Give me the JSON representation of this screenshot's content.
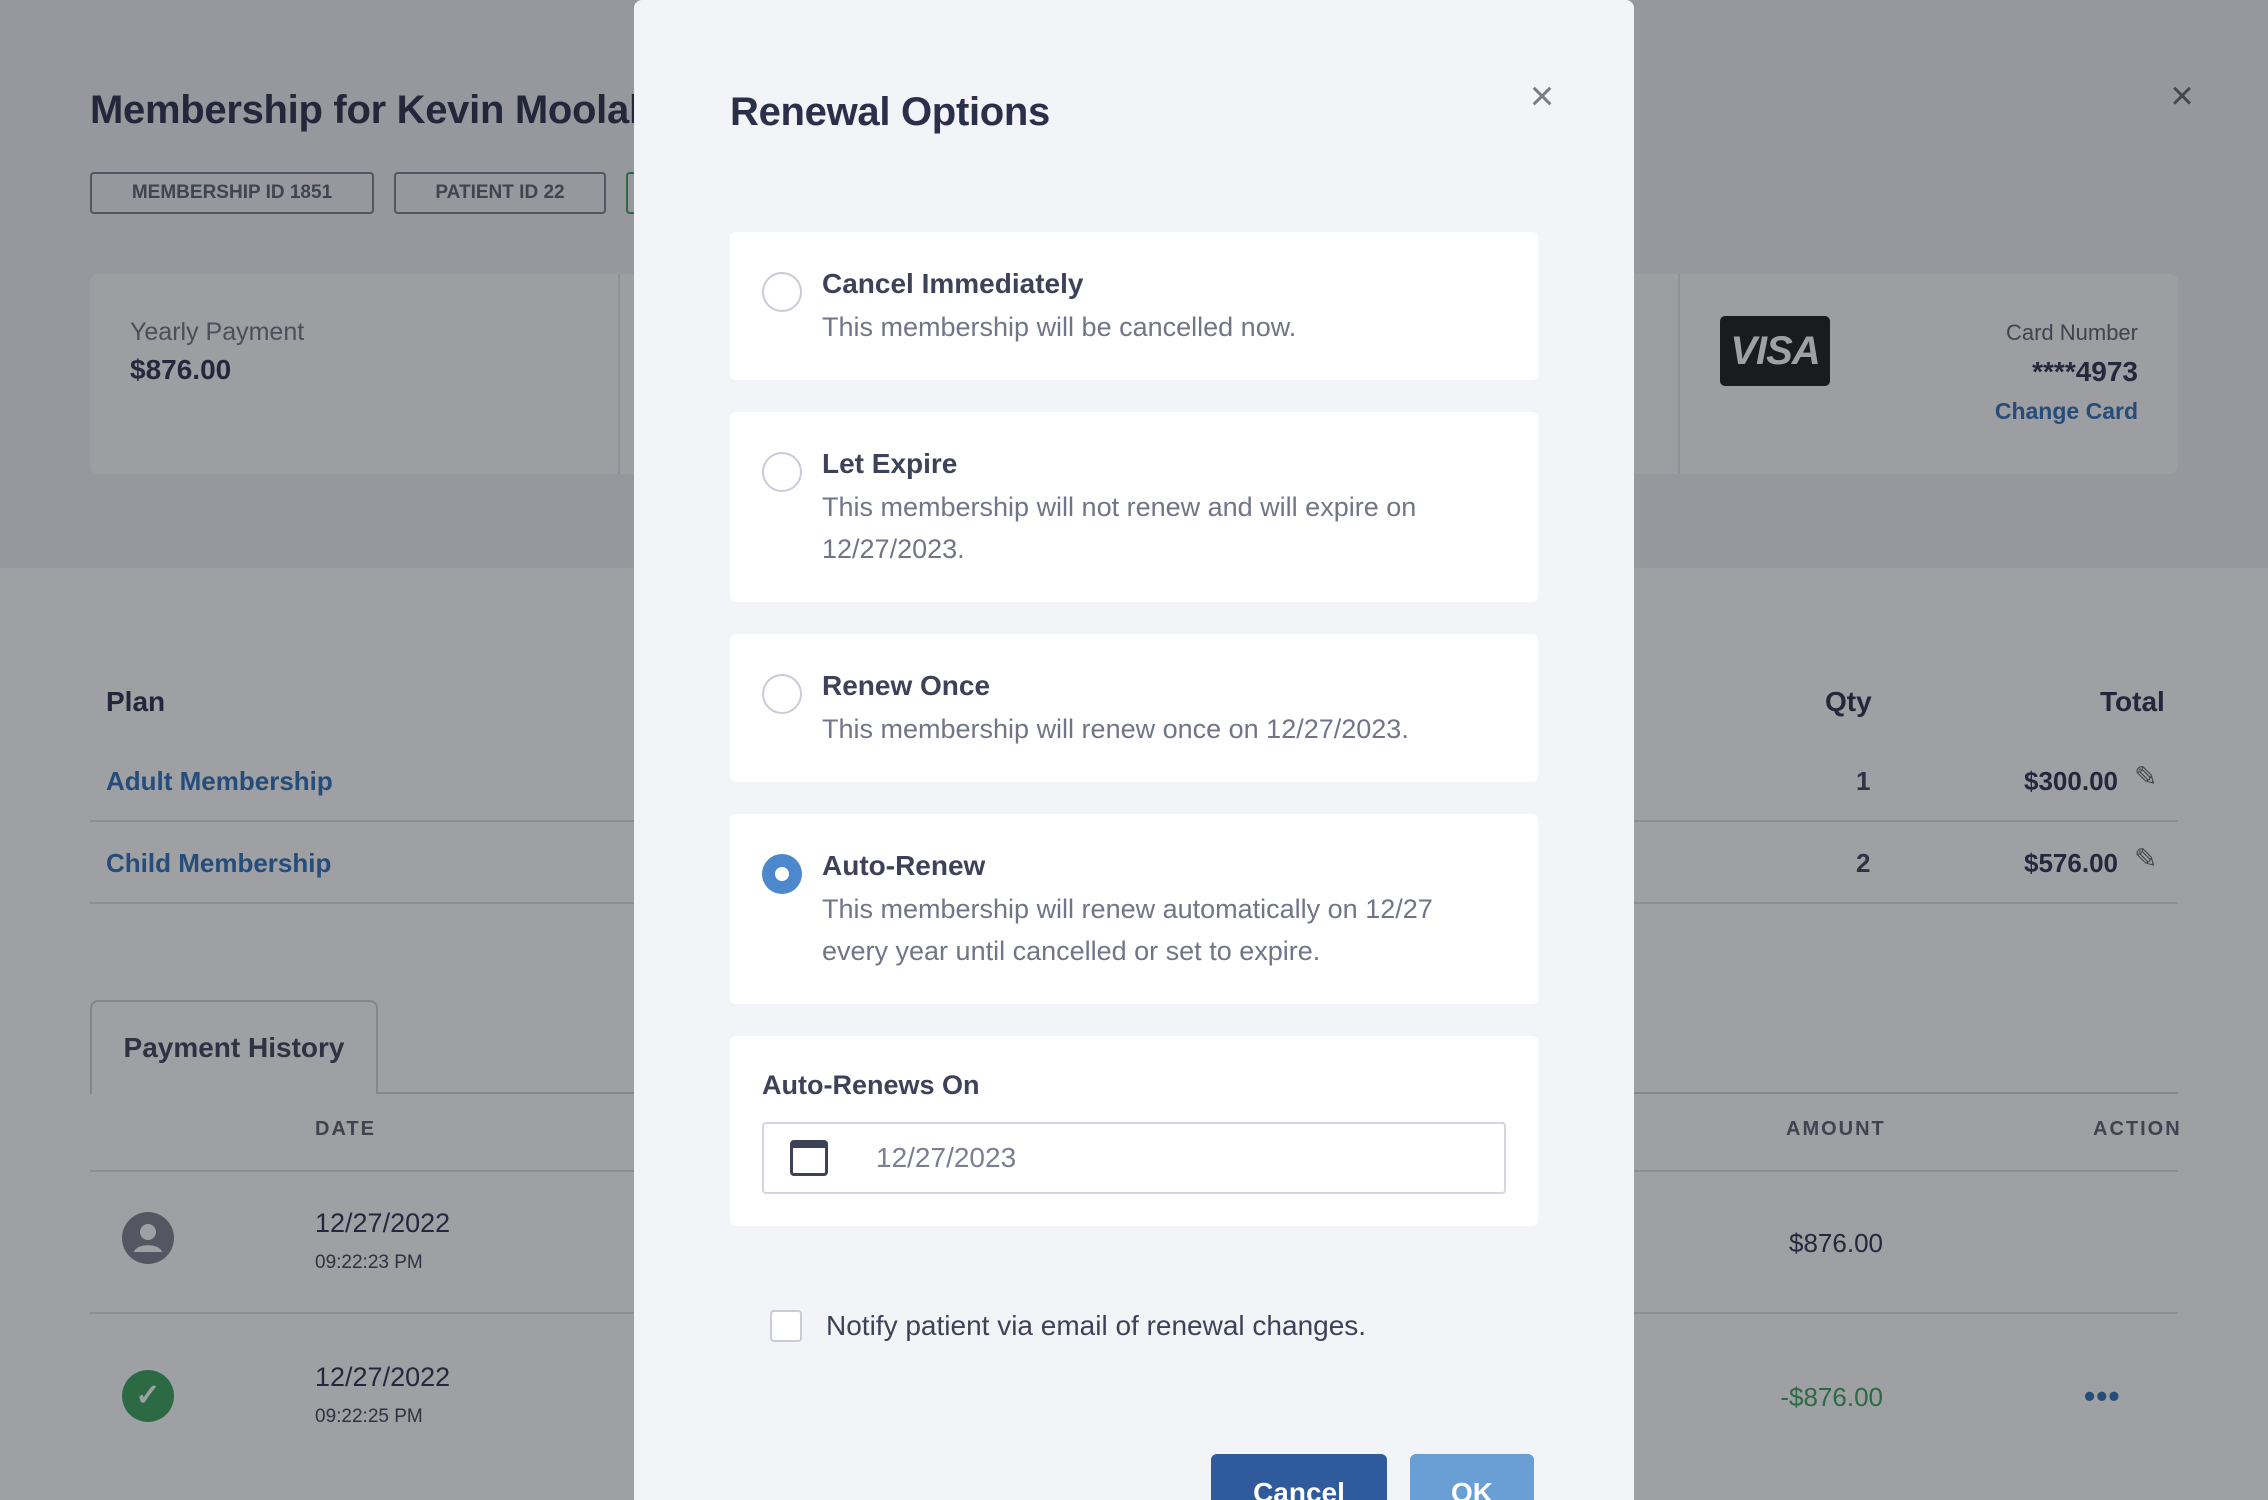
{
  "page": {
    "title": "Membership for Kevin Moolah",
    "close_icon": "×",
    "chips": [
      "MEMBERSHIP ID 1851",
      "PATIENT ID 22"
    ],
    "summary": {
      "payment_label": "Yearly Payment",
      "payment_value": "$876.00",
      "card_brand": "VISA",
      "card_number_label": "Card Number",
      "card_number": "****4973",
      "change_card": "Change Card"
    },
    "plans": {
      "headers": {
        "plan": "Plan",
        "qty": "Qty",
        "total": "Total"
      },
      "rows": [
        {
          "name": "Adult Membership",
          "qty": "1",
          "total": "$300.00"
        },
        {
          "name": "Child Membership",
          "qty": "2",
          "total": "$576.00"
        }
      ],
      "edit_icon": "✎"
    },
    "history": {
      "tab": "Payment History",
      "headers": {
        "date": "DATE",
        "amount": "AMOUNT",
        "action": "ACTION"
      },
      "rows": [
        {
          "icon": "user-icon",
          "date": "12/27/2022",
          "time": "09:22:23 PM",
          "amount": "$876.00"
        },
        {
          "icon": "check-icon",
          "date": "12/27/2022",
          "time": "09:22:25 PM",
          "amount": "-$876.00",
          "action": "•••"
        }
      ]
    }
  },
  "modal": {
    "title": "Renewal Options",
    "close_icon": "×",
    "options": [
      {
        "title": "Cancel Immediately",
        "desc": "This membership will be cancelled now.",
        "selected": false
      },
      {
        "title": "Let Expire",
        "desc": "This membership will not renew and will expire on 12/27/2023.",
        "selected": false
      },
      {
        "title": "Renew Once",
        "desc": "This membership will renew once on 12/27/2023.",
        "selected": false
      },
      {
        "title": "Auto-Renew",
        "desc": "This membership will renew automatically on 12/27 every year until cancelled or set to expire.",
        "selected": true
      }
    ],
    "renews_on": {
      "label": "Auto-Renews On",
      "value": "12/27/2023"
    },
    "notify_label": "Notify patient via email of renewal changes.",
    "notify_checked": false,
    "buttons": {
      "cancel": "Cancel",
      "ok": "OK"
    }
  },
  "colors": {
    "accent": "#4d88cc",
    "link": "#2f6fb7",
    "success": "#3aa35c",
    "primary_button": "#2f5b9c",
    "ok_button": "#6a9fd6"
  }
}
